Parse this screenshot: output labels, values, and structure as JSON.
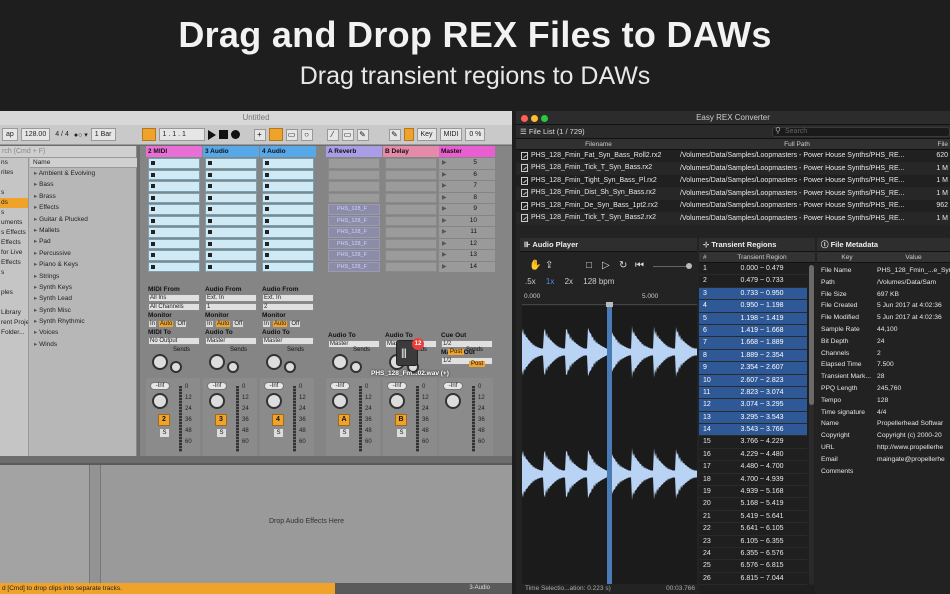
{
  "hero": {
    "title": "Drag and Drop REX Files to DAWs",
    "subtitle": "Drag transient regions to DAWs"
  },
  "ableton": {
    "window_title": "Untitled",
    "toolbar": {
      "tap": "ap",
      "tempo": "128.00",
      "signature": "4 / 4",
      "quantize": "1 Bar",
      "position": "1 .  1 .  1",
      "key": "Key",
      "midi": "MIDI",
      "cpu": "0 %"
    },
    "browser": {
      "search_placeholder": "rch (Cmd + F)",
      "places": [
        "ns",
        "rites",
        "",
        "s",
        "ds",
        "s",
        "uments",
        "s Effects",
        "Effects",
        "for Live",
        "Effects",
        "s",
        "",
        "ples",
        "",
        "Library",
        "rent Projec",
        "Folder..."
      ],
      "column_header": "Name",
      "items": [
        "Ambient & Evolving",
        "Bass",
        "Brass",
        "Effects",
        "Guitar & Plucked",
        "Mallets",
        "Pad",
        "Percussive",
        "Piano & Keys",
        "Strings",
        "Synth Keys",
        "Synth Lead",
        "Synth Misc",
        "Synth Rhythmic",
        "Voices",
        "Winds"
      ]
    },
    "tracks": [
      {
        "name": "2 MIDI",
        "color": "#e96fd6",
        "io_from_label": "MIDI From",
        "io_from": "All Ins",
        "io_ch": "All Channels",
        "io_to_label": "MIDI To",
        "io_to": "No Output",
        "num": "2"
      },
      {
        "name": "3 Audio",
        "color": "#57a8e8",
        "io_from_label": "Audio From",
        "io_from": "Ext. In",
        "io_ch": "1",
        "io_to_label": "Audio To",
        "io_to": "Master",
        "num": "3"
      },
      {
        "name": "4 Audio",
        "color": "#57a8e8",
        "io_from_label": "Audio From",
        "io_from": "Ext. In",
        "io_ch": "2",
        "io_to_label": "Audio To",
        "io_to": "Master",
        "num": "4"
      },
      {
        "name": "A Reverb",
        "color": "#a99de8",
        "io_to_label": "Audio To",
        "io_to": "Master",
        "num": "A"
      },
      {
        "name": "B Delay",
        "color": "#e58aa8",
        "io_to_label": "Audio To",
        "io_to": "Master",
        "num": "B"
      },
      {
        "name": "Master",
        "color": "#e95ed0",
        "io_to_label": "Cue Out",
        "io_to": "1/2",
        "extra_label": "Master Out",
        "extra": "1/2"
      }
    ],
    "monitor_label": "Monitor",
    "monitor_opts": [
      "In",
      "Auto",
      "Off"
    ],
    "sends_label": "Sends",
    "post_label": "Post",
    "fader_value": "-Inf",
    "db_ticks": [
      "0",
      "12",
      "24",
      "36",
      "48",
      "60"
    ],
    "solo": "S",
    "scenes": [
      "5",
      "6",
      "7",
      "8",
      "9",
      "10",
      "11",
      "12",
      "13",
      "14"
    ],
    "ghost_clip": "PHS_128_F",
    "drag_badge": "12",
    "drag_label": "PHS_128_Fm...02.wav (+)",
    "detail_drop": "Drop Audio Effects Here",
    "status_msg": "d [Cmd] to drop clips into separate tracks.",
    "status_right": "3-Audio"
  },
  "rex": {
    "window_title": "Easy REX Converter",
    "file_list_title": "File List (1 / 729)",
    "search_placeholder": "Search",
    "file_columns": [
      "Filename",
      "Full Path",
      "File"
    ],
    "files": [
      {
        "name": "PHS_128_Fmin_Fat_Syn_Bass_Roll2.rx2",
        "path": "/Volumes/Data/Samples/Loopmasters - Power House Synths/PHS_RE...",
        "size": "620"
      },
      {
        "name": "PHS_128_Fmin_Tick_T_Syn_Bass.rx2",
        "path": "/Volumes/Data/Samples/Loopmasters - Power House Synths/PHS_RE...",
        "size": "1 M"
      },
      {
        "name": "PHS_128_Fmin_Tight_Syn_Bass_Pl.rx2",
        "path": "/Volumes/Data/Samples/Loopmasters - Power House Synths/PHS_RE...",
        "size": "1 M"
      },
      {
        "name": "PHS_128_Fmin_Dist_Sh_Syn_Bass.rx2",
        "path": "/Volumes/Data/Samples/Loopmasters - Power House Synths/PHS_RE...",
        "size": "1 M"
      },
      {
        "name": "PHS_128_Fmin_De_Syn_Bass_1pt2.rx2",
        "path": "/Volumes/Data/Samples/Loopmasters - Power House Synths/PHS_RE...",
        "size": "962"
      },
      {
        "name": "PHS_128_Fmin_Tick_T_Syn_Bass2.rx2",
        "path": "/Volumes/Data/Samples/Loopmasters - Power House Synths/PHS_RE...",
        "size": "1 M"
      }
    ],
    "audio_player": {
      "title": "Audio Player",
      "zoom_options": [
        ".5x",
        "1x",
        "2x"
      ],
      "zoom_active": "1x",
      "bpm": "128  bpm",
      "ruler_start": "0.000",
      "ruler_mid": "5.000",
      "status_left": "Time Selectio...ation: 0.223 s)",
      "status_right": "00:03.766",
      "selection_fraction": 0.49
    },
    "transient_regions": {
      "title": "Transient Regions",
      "col_index": "#",
      "col_region": "Transient Region",
      "rows": [
        {
          "i": "1",
          "r": "0.000 ~ 0.479",
          "sel": false
        },
        {
          "i": "2",
          "r": "0.479 ~ 0.733",
          "sel": false
        },
        {
          "i": "3",
          "r": "0.733 ~ 0.950",
          "sel": true
        },
        {
          "i": "4",
          "r": "0.950 ~ 1.198",
          "sel": true
        },
        {
          "i": "5",
          "r": "1.198 ~ 1.419",
          "sel": true
        },
        {
          "i": "6",
          "r": "1.419 ~ 1.668",
          "sel": true
        },
        {
          "i": "7",
          "r": "1.668 ~ 1.889",
          "sel": true
        },
        {
          "i": "8",
          "r": "1.889 ~ 2.354",
          "sel": true
        },
        {
          "i": "9",
          "r": "2.354 ~ 2.607",
          "sel": true
        },
        {
          "i": "10",
          "r": "2.607 ~ 2.823",
          "sel": true
        },
        {
          "i": "11",
          "r": "2.823 ~ 3.074",
          "sel": true
        },
        {
          "i": "12",
          "r": "3.074 ~ 3.295",
          "sel": true
        },
        {
          "i": "13",
          "r": "3.295 ~ 3.543",
          "sel": true
        },
        {
          "i": "14",
          "r": "3.543 ~ 3.766",
          "sel": true
        },
        {
          "i": "15",
          "r": "3.766 ~ 4.229",
          "sel": false
        },
        {
          "i": "16",
          "r": "4.229 ~ 4.480",
          "sel": false
        },
        {
          "i": "17",
          "r": "4.480 ~ 4.700",
          "sel": false
        },
        {
          "i": "18",
          "r": "4.700 ~ 4.939",
          "sel": false
        },
        {
          "i": "19",
          "r": "4.939 ~ 5.168",
          "sel": false
        },
        {
          "i": "20",
          "r": "5.168 ~ 5.419",
          "sel": false
        },
        {
          "i": "21",
          "r": "5.419 ~ 5.641",
          "sel": false
        },
        {
          "i": "22",
          "r": "5.641 ~ 6.105",
          "sel": false
        },
        {
          "i": "23",
          "r": "6.105 ~ 6.355",
          "sel": false
        },
        {
          "i": "24",
          "r": "6.355 ~ 6.576",
          "sel": false
        },
        {
          "i": "25",
          "r": "6.576 ~ 6.815",
          "sel": false
        },
        {
          "i": "26",
          "r": "6.815 ~ 7.044",
          "sel": false
        }
      ]
    },
    "file_metadata": {
      "title": "File Metadata",
      "col_key": "Key",
      "col_value": "Value",
      "rows": [
        {
          "k": "File Name",
          "v": "PHS_128_Fmin_...e_Syn"
        },
        {
          "k": "Path",
          "v": "/Volumes/Data/Sam"
        },
        {
          "k": "File Size",
          "v": "697 KB"
        },
        {
          "k": "File Created",
          "v": "5 Jun 2017 at 4:02:36"
        },
        {
          "k": "File Modified",
          "v": "5 Jun 2017 at 4:02:36"
        },
        {
          "k": "Sample Rate",
          "v": "44,100"
        },
        {
          "k": "Bit Depth",
          "v": "24"
        },
        {
          "k": "Channels",
          "v": "2"
        },
        {
          "k": "Elapsed Time",
          "v": "7.500"
        },
        {
          "k": "Transient Mark...",
          "v": "28"
        },
        {
          "k": "PPQ Length",
          "v": "245,760"
        },
        {
          "k": "Tempo",
          "v": "128"
        },
        {
          "k": "Time signature",
          "v": "4/4"
        },
        {
          "k": "Name",
          "v": "Propellerhead Softwar"
        },
        {
          "k": "Copyright",
          "v": "Copyright (c) 2000-20"
        },
        {
          "k": "URL",
          "v": "http://www.propellerhe"
        },
        {
          "k": "Email",
          "v": "maingate@propellerhe"
        },
        {
          "k": "Comments",
          "v": ""
        }
      ]
    }
  }
}
